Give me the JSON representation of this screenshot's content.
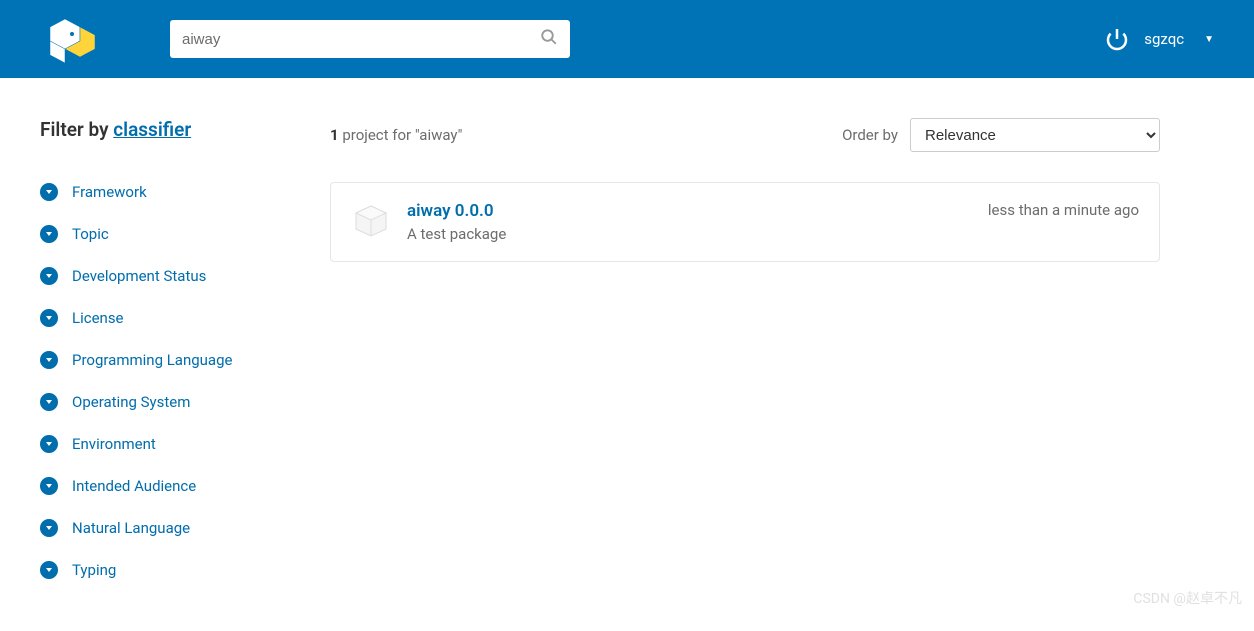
{
  "search": {
    "value": "aiway",
    "placeholder": ""
  },
  "user": {
    "name": "sgzqc"
  },
  "sidebar": {
    "title_prefix": "Filter by ",
    "title_link": "classifier",
    "filters": [
      {
        "label": "Framework"
      },
      {
        "label": "Topic"
      },
      {
        "label": "Development Status"
      },
      {
        "label": "License"
      },
      {
        "label": "Programming Language"
      },
      {
        "label": "Operating System"
      },
      {
        "label": "Environment"
      },
      {
        "label": "Intended Audience"
      },
      {
        "label": "Natural Language"
      },
      {
        "label": "Typing"
      }
    ]
  },
  "results": {
    "count": "1",
    "text_middle": " project for \"",
    "query": "aiway",
    "text_end": "\"",
    "order_by_label": "Order by",
    "order_by_selected": "Relevance"
  },
  "package": {
    "name": "aiway 0.0.0",
    "description": "A test package",
    "time": "less than a minute ago"
  },
  "watermark": "CSDN @赵卓不凡"
}
